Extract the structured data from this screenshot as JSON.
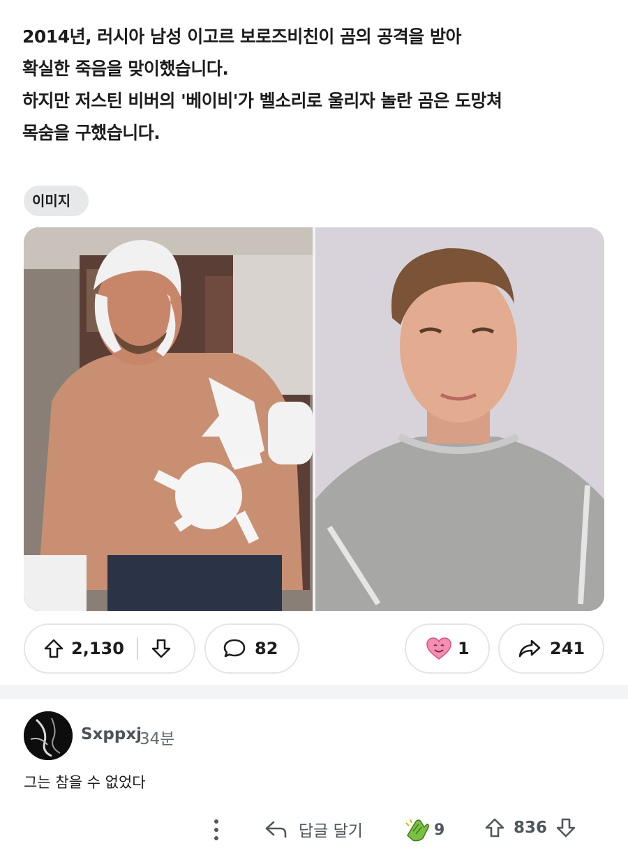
{
  "post": {
    "lines": [
      "2014년, 러시아 남성 이고르 보로즈비친이 곰의 공격을 받아",
      "확실한 죽음을 맞이했습니다.",
      "하지만 저스틴 비버의 '베이비'가 벨소리로 울리자 놀란 곰은 도망쳐",
      "목숨을 구했습니다."
    ],
    "tag": "이미지"
  },
  "images": {
    "left_desc": "bandaged-man",
    "right_desc": "singer-portrait"
  },
  "actions": {
    "upvotes": "2,130",
    "comments": "82",
    "awards": "1",
    "shares": "241"
  },
  "comment": {
    "username": "Sxppxj",
    "time": "34분",
    "body": "그는 참을 수 없었다",
    "reply_label": "답글 달기",
    "award_count": "9",
    "vote_count": "836"
  },
  "colors": {
    "pill_border": "#e3e5e7",
    "tag_bg": "#e6e8ea",
    "heart_pink": "#f48fb1",
    "award_green": "#7cc043"
  }
}
